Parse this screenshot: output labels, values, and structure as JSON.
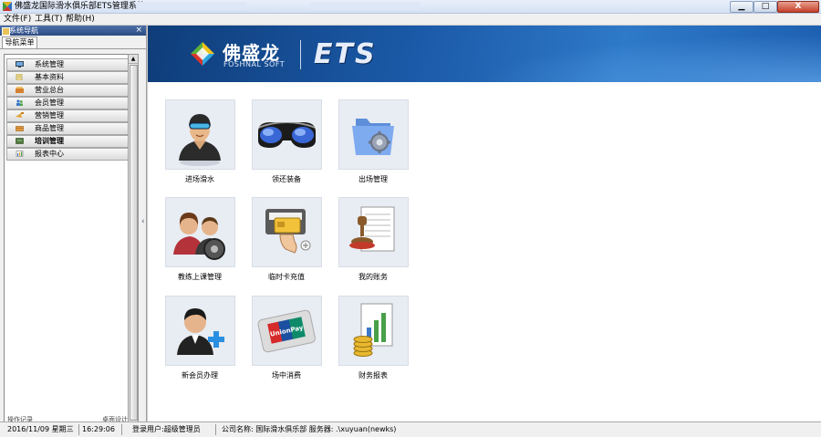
{
  "window": {
    "title": "佛盛龙国际滑水俱乐部ETS管理系统",
    "close_label": "X"
  },
  "menu": [
    {
      "label": "文件(F)"
    },
    {
      "label": "工具(T)"
    },
    {
      "label": "帮助(H)"
    }
  ],
  "left_panel": {
    "header": "系统导航",
    "close": "×",
    "tab": "导航菜单",
    "nav_items": [
      {
        "label": "系统管理",
        "icon": "monitor-icon"
      },
      {
        "label": "基本资料",
        "icon": "document-icon"
      },
      {
        "label": "营业总台",
        "icon": "counter-icon"
      },
      {
        "label": "会员管理",
        "icon": "members-icon"
      },
      {
        "label": "营销管理",
        "icon": "marketing-icon"
      },
      {
        "label": "商品管理",
        "icon": "goods-icon"
      },
      {
        "label": "培训管理",
        "icon": "training-icon",
        "selected": true
      },
      {
        "label": "报表中心",
        "icon": "report-icon"
      }
    ],
    "bottom_tabs": [
      "操作记录",
      "桌面设计"
    ]
  },
  "banner": {
    "brand_cn": "佛盛龙",
    "brand_en": "FOSHNAL SOFT",
    "product": "ETS",
    "colors": {
      "bg_dark": "#0f3d7a",
      "bg_light": "#2e79c8"
    }
  },
  "modules": [
    {
      "label": "进场滑水",
      "icon": "swimmer-icon"
    },
    {
      "label": "领还装备",
      "icon": "goggles-icon"
    },
    {
      "label": "出场管理",
      "icon": "folder-gear-icon"
    },
    {
      "label": "教练上课管理",
      "icon": "coach-icon"
    },
    {
      "label": "临时卡充值",
      "icon": "card-reader-icon"
    },
    {
      "label": "我的账务",
      "icon": "stamp-document-icon"
    },
    {
      "label": "新会员办理",
      "icon": "new-member-icon"
    },
    {
      "label": "场中消费",
      "icon": "unionpay-card-icon"
    },
    {
      "label": "财务报表",
      "icon": "financial-report-icon"
    }
  ],
  "statusbar": {
    "date": "2016/11/09 星期三",
    "time": "16:29:06",
    "user": "登录用户:超级管理员",
    "company": "公司名称: 国际滑水俱乐部 服务器: .\\xuyuan(newks)"
  }
}
